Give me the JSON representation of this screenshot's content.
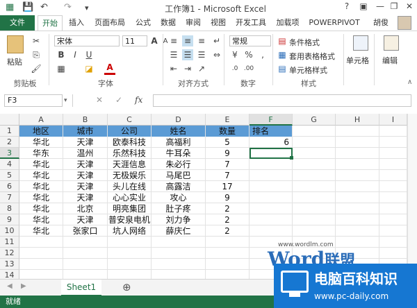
{
  "title_bar": {
    "title": "工作簿1 - Microsoft Excel",
    "help": "?",
    "minimize": "—",
    "restore": "❐",
    "close": "✕"
  },
  "ribbon_tabs": [
    {
      "label": "文件"
    },
    {
      "label": "开始"
    },
    {
      "label": "插入"
    },
    {
      "label": "页面布局"
    },
    {
      "label": "公式"
    },
    {
      "label": "数据"
    },
    {
      "label": "审阅"
    },
    {
      "label": "视图"
    },
    {
      "label": "开发工具"
    },
    {
      "label": "加载项"
    },
    {
      "label": "POWERPIVOT"
    },
    {
      "label": "胡俊"
    }
  ],
  "ribbon": {
    "paste_label": "粘贴",
    "font_name": "宋体",
    "font_size": "11",
    "bold": "B",
    "italic": "I",
    "underline": "U",
    "grow_font": "A",
    "shrink_font": "A",
    "number_format": "常规",
    "percent": "%",
    "comma": ",",
    "cond_format": "条件格式",
    "table_format": "套用表格格式",
    "cell_styles": "单元格样式",
    "cells_label": "单元格",
    "edit_label": "编辑",
    "groups": [
      "剪贴板",
      "字体",
      "对齐方式",
      "数字",
      "样式"
    ]
  },
  "formula_bar": {
    "name_box": "F3",
    "cancel": "✕",
    "enter": "✓",
    "fx": "fx",
    "formula": ""
  },
  "columns": [
    "A",
    "B",
    "C",
    "D",
    "E",
    "F",
    "G",
    "H",
    "I"
  ],
  "rows": [
    "1",
    "2",
    "3",
    "4",
    "5",
    "6",
    "7",
    "8",
    "9",
    "10",
    "11",
    "12",
    "13",
    "14"
  ],
  "table": {
    "headers": [
      "地区",
      "城市",
      "公司",
      "姓名",
      "数量",
      "排名"
    ],
    "rows": [
      [
        "华北",
        "天津",
        "欧泰科技",
        "高福利",
        "5",
        "6"
      ],
      [
        "华东",
        "温州",
        "乐然科技",
        "牛耳朵",
        "9",
        ""
      ],
      [
        "华北",
        "天津",
        "天涯信息",
        "朱必行",
        "7",
        ""
      ],
      [
        "华北",
        "天津",
        "无极娱乐",
        "马尾巴",
        "7",
        ""
      ],
      [
        "华北",
        "天津",
        "头儿在线",
        "高露洁",
        "17",
        ""
      ],
      [
        "华北",
        "天津",
        "心心实业",
        "攻心",
        "9",
        ""
      ],
      [
        "华北",
        "北京",
        "明亮集团",
        "肚子疼",
        "2",
        ""
      ],
      [
        "华北",
        "天津",
        "普安泉电机",
        "刘力争",
        "2",
        ""
      ],
      [
        "华北",
        "张家口",
        "坑人网络",
        "薛庆仁",
        "2",
        ""
      ]
    ]
  },
  "sheet_tabs": [
    {
      "label": "Sheet1"
    }
  ],
  "add_sheet": "⊕",
  "status": "就绪",
  "watermark": {
    "word_url": "www.wordlm.com",
    "word_brand": "Word",
    "word_cn": "联盟",
    "pc_title": "电脑百科知识",
    "pc_url": "www.pc-daily.com"
  },
  "colors": {
    "excel_green": "#217346",
    "header_fill": "#5b9bd5",
    "badge_blue": "#1677d2"
  }
}
